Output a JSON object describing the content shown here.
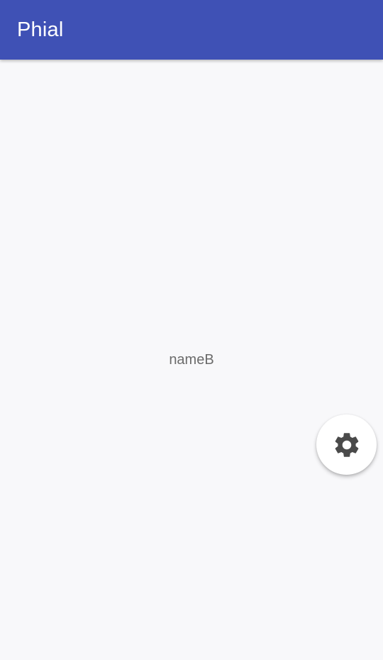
{
  "app_bar": {
    "title": "Phial",
    "color": "#3f51b5"
  },
  "main": {
    "center_text": "nameB"
  },
  "fab": {
    "icon": "gear-icon"
  }
}
